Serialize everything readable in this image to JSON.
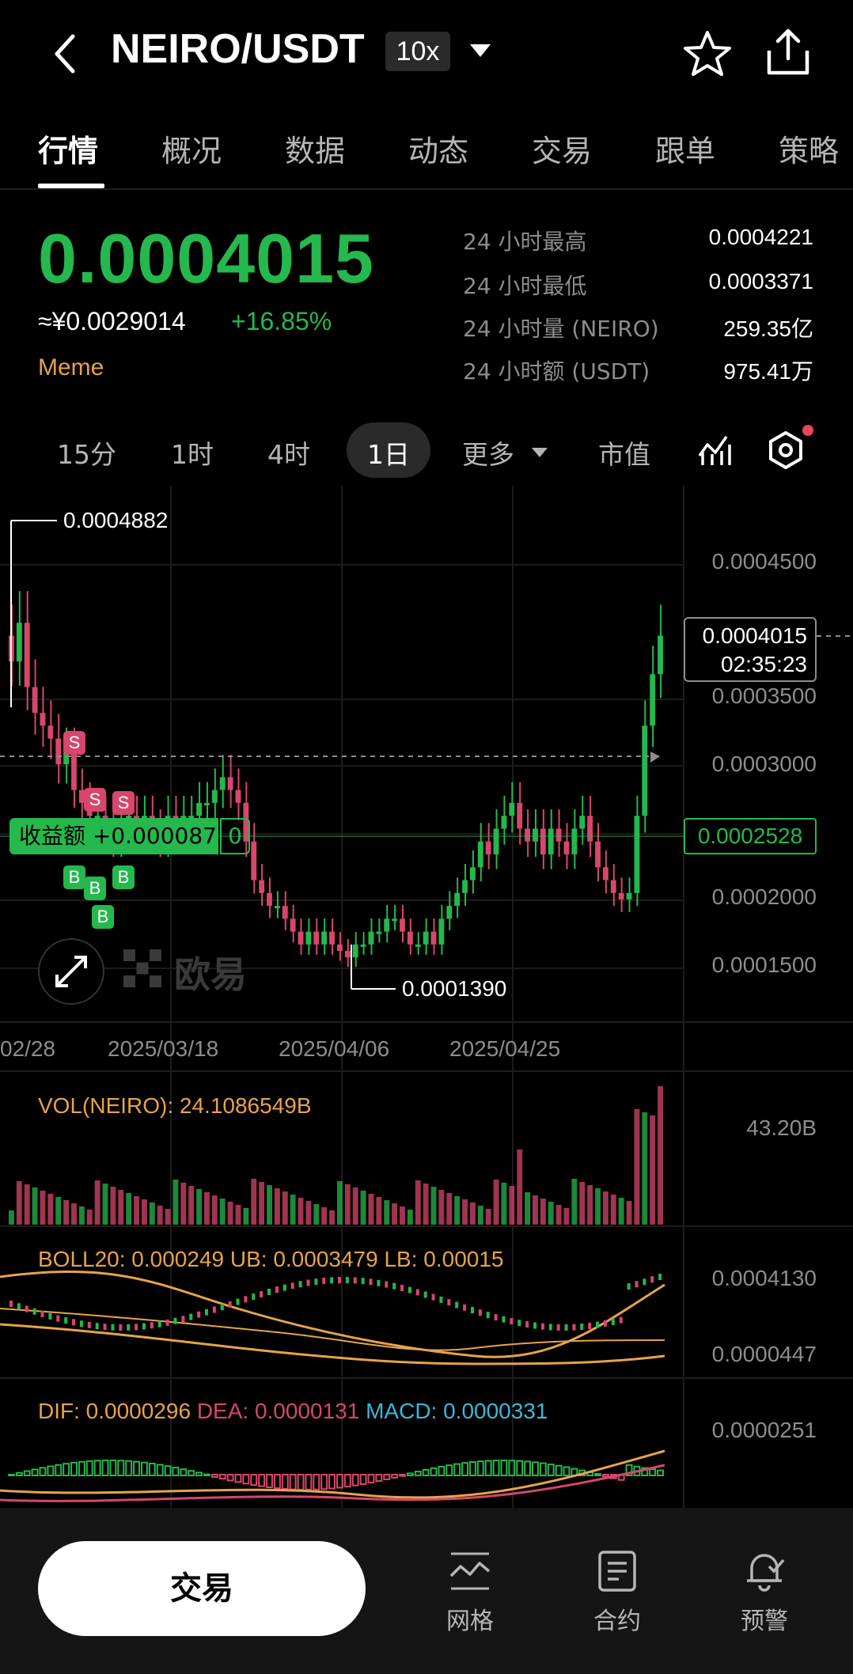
{
  "header": {
    "pair": "NEIRO/USDT",
    "leverage": "10x"
  },
  "tabs": [
    "行情",
    "概况",
    "数据",
    "动态",
    "交易",
    "跟单",
    "策略"
  ],
  "ticker": {
    "price": "0.0004015",
    "cny": "≈¥0.0029014",
    "change": "+16.85%",
    "tag": "Meme",
    "stats": [
      {
        "label": "24 小时最高",
        "value": "0.0004221"
      },
      {
        "label": "24 小时最低",
        "value": "0.0003371"
      },
      {
        "label": "24 小时量 (NEIRO)",
        "value": "259.35亿"
      },
      {
        "label": "24 小时额 (USDT)",
        "value": "975.41万"
      }
    ]
  },
  "intervals": {
    "items": [
      "15分",
      "1时",
      "4时"
    ],
    "active": "1日",
    "more": "更多",
    "marketcap": "市值"
  },
  "chart": {
    "high_marker": "0.0004882",
    "low_marker": "0.0001390",
    "price_labels": [
      "0.0004500",
      "0.0003500",
      "0.0003000",
      "0.0002000",
      "0.0001500"
    ],
    "current_price": "0.0004015",
    "countdown": "02:35:23",
    "entry_price": "0.0002528",
    "pnl_label": "收益额 +0.000087",
    "pnl_extra": "0",
    "watermark": "欧易",
    "dates": [
      "02/28",
      "2025/03/18",
      "2025/04/06",
      "2025/04/25"
    ],
    "sell_marker": "S",
    "buy_marker": "B"
  },
  "vol": {
    "label": "VOL(NEIRO): 24.1086549B",
    "max": "43.20B"
  },
  "boll": {
    "label_boll": "BOLL20: 0.000249",
    "label_ub": "UB: 0.0003479",
    "label_lb": "LB: 0.00015",
    "upper": "0.0004130",
    "lower": "0.0000447"
  },
  "macd": {
    "dif": "DIF: 0.0000296",
    "dea": "DEA: 0.0000131",
    "macd": "MACD: 0.0000331",
    "upper": "0.0000251"
  },
  "bottom": {
    "trade": "交易",
    "grid": "网格",
    "contract": "合约",
    "alert": "预警"
  },
  "colors": {
    "up": "#25b84d",
    "down": "#d6476b",
    "accent": "#e7a34a"
  }
}
